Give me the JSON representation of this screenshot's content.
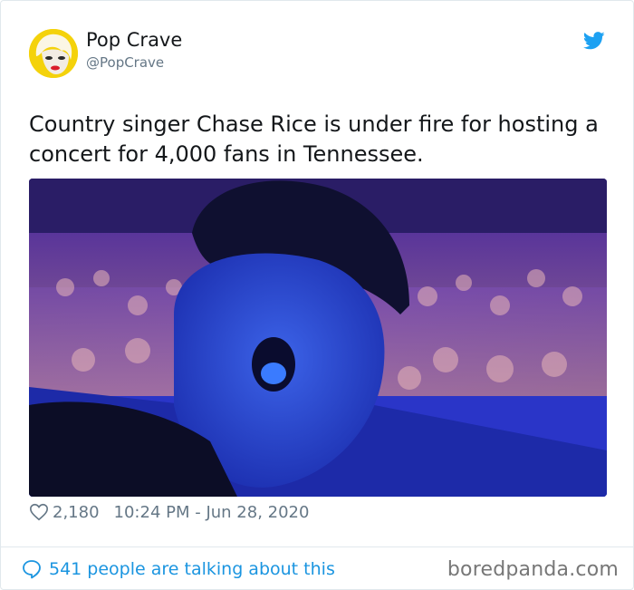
{
  "tweet": {
    "author_name": "Pop Crave",
    "author_handle": "@PopCrave",
    "text": "Country singer Chase Rice is under fire for hosting a concert for 4,000 fans in Tennessee.",
    "likes": "2,180",
    "timestamp": "10:24 PM - Jun 28, 2020",
    "talking": "541 people are talking about this"
  },
  "watermark": "boredpanda.com",
  "colors": {
    "twitter_blue": "#1da1f2",
    "link_blue": "#1b95e0",
    "muted_gray": "#657786",
    "border": "#e1e8ed"
  },
  "icons": {
    "brand": "twitter-bird-icon",
    "like": "heart-icon",
    "reply": "speech-bubble-icon"
  }
}
